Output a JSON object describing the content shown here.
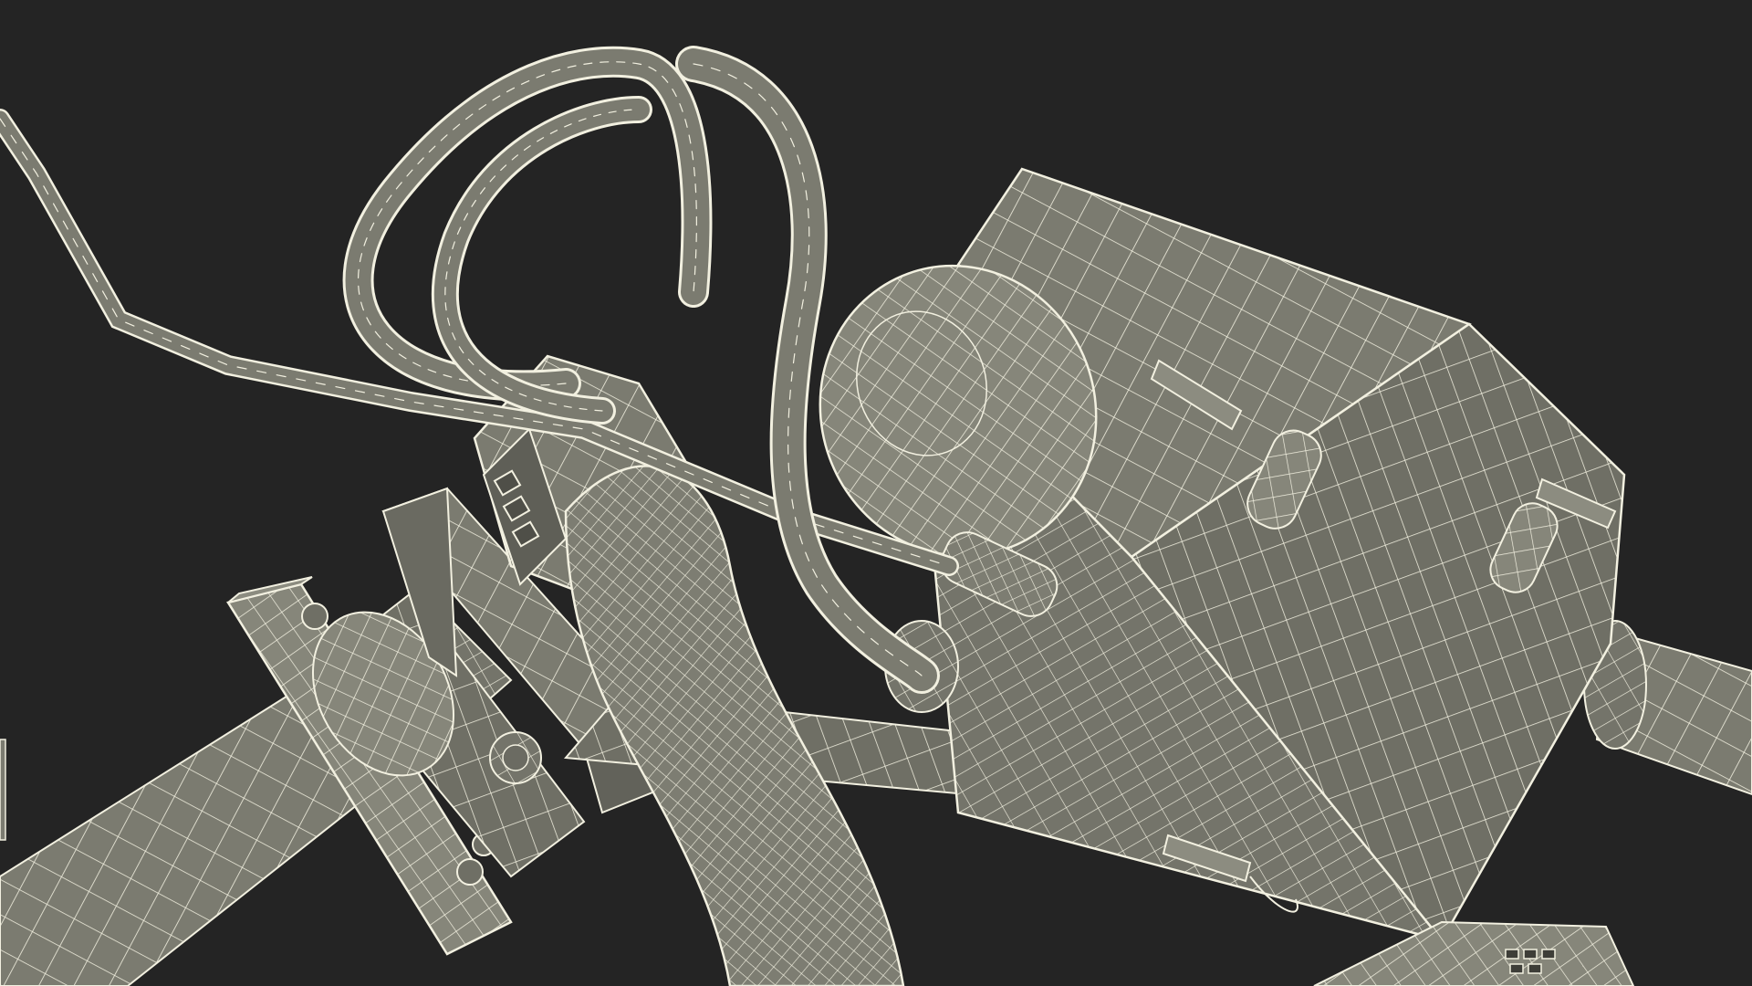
{
  "scene": {
    "background_color": "#242424",
    "surface_color": "#7b7b70",
    "surface_shade_color": "#62625a",
    "surface_light_color": "#8c8c80",
    "wire_color": "#f2f0e0"
  }
}
